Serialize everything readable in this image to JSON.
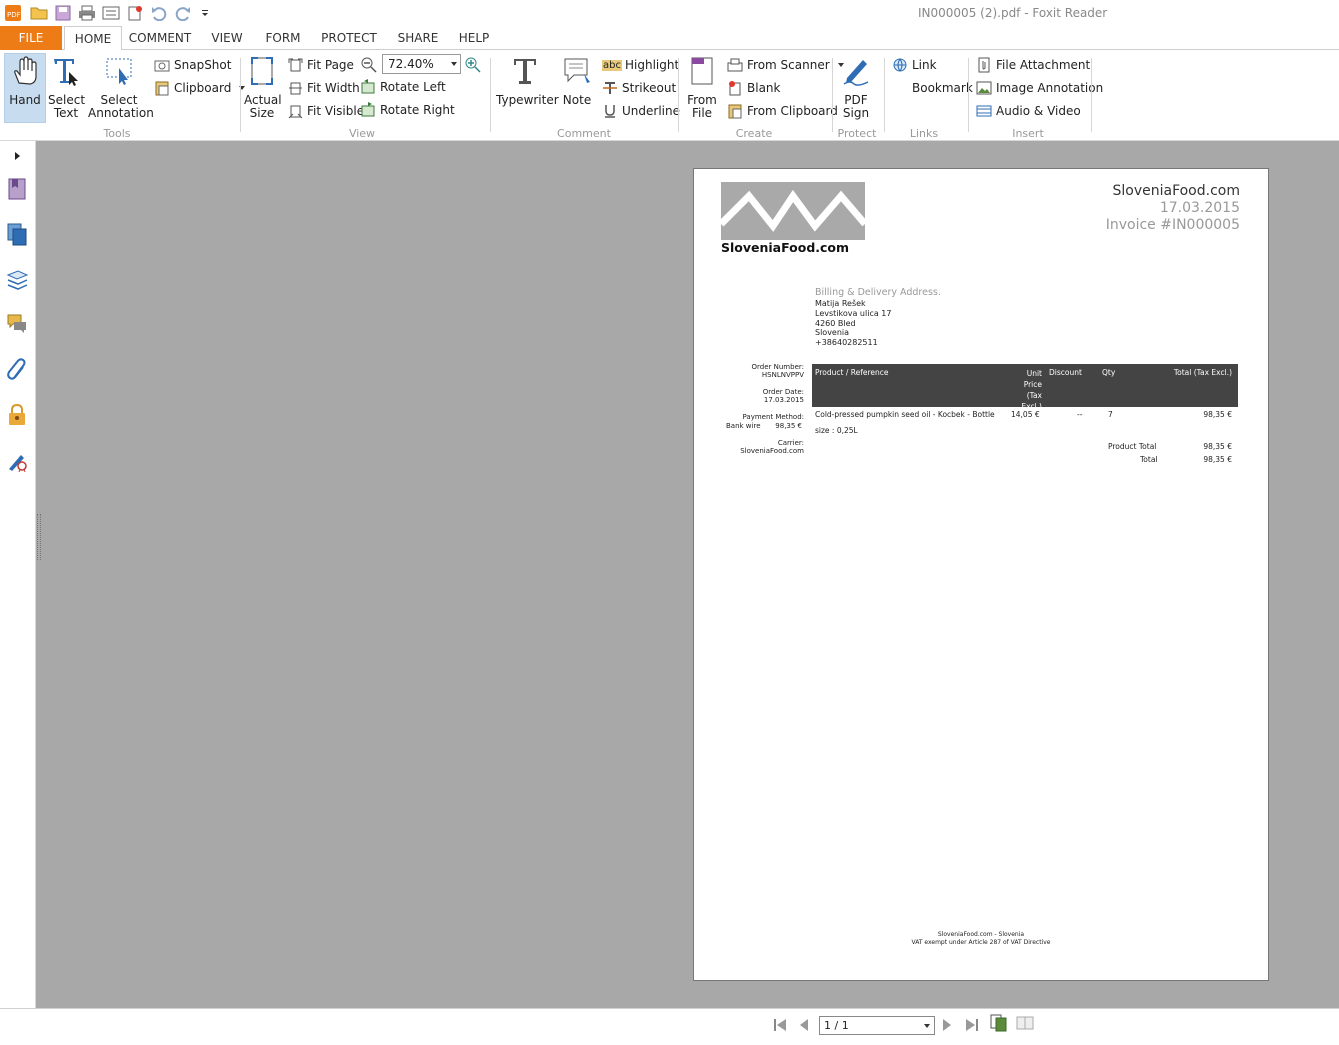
{
  "window": {
    "title": "IN000005 (2).pdf - Foxit Reader"
  },
  "tabs": [
    "FILE",
    "HOME",
    "COMMENT",
    "VIEW",
    "FORM",
    "PROTECT",
    "SHARE",
    "HELP"
  ],
  "ribbon": {
    "tools": {
      "hand": "Hand",
      "select_text_1": "Select",
      "select_text_2": "Text",
      "select_annot_1": "Select",
      "select_annot_2": "Annotation",
      "snapshot": "SnapShot",
      "clipboard": "Clipboard",
      "group": "Tools"
    },
    "view": {
      "actual_1": "Actual",
      "actual_2": "Size",
      "fit_page": "Fit Page",
      "fit_width": "Fit Width",
      "fit_visible": "Fit Visible",
      "zoom": "72.40%",
      "rotate_left": "Rotate Left",
      "rotate_right": "Rotate Right",
      "group": "View"
    },
    "comment": {
      "typewriter": "Typewriter",
      "note": "Note",
      "highlight": "Highlight",
      "strikeout": "Strikeout",
      "underline": "Underline",
      "group": "Comment",
      "abc": "abc"
    },
    "create": {
      "from_file_1": "From",
      "from_file_2": "File",
      "from_scanner": "From Scanner",
      "blank": "Blank",
      "from_clipboard": "From Clipboard",
      "group": "Create"
    },
    "protect": {
      "pdf_sign_1": "PDF",
      "pdf_sign_2": "Sign",
      "group": "Protect"
    },
    "links": {
      "link": "Link",
      "bookmark": "Bookmark",
      "group": "Links"
    },
    "insert": {
      "file_attachment": "File Attachment",
      "image_annotation": "Image Annotation",
      "audio_video": "Audio & Video",
      "group": "Insert"
    }
  },
  "status": {
    "page_indicator": "1 / 1"
  },
  "invoice": {
    "logo_text": "SloveniaFood.com",
    "shop_name": "SloveniaFood.com",
    "date": "17.03.2015",
    "invoice_no": "Invoice #IN000005",
    "address_label": "Billing & Delivery Address.",
    "address_lines": [
      "Matija Rešek",
      "Levstikova ulica 17",
      "4260 Bled",
      "Slovenia",
      "+38640282511"
    ],
    "order_number_label": "Order Number:",
    "order_number": "HSNLNVPPV",
    "order_date_label": "Order Date:",
    "order_date": "17.03.2015",
    "payment_label": "Payment Method:",
    "payment_method": "Bank wire",
    "payment_amount": "98,35 €",
    "carrier_label": "Carrier:",
    "carrier": "SloveniaFood.com",
    "table_headers": {
      "product": "Product / Reference",
      "unit_price": [
        "Unit",
        "Price",
        "(Tax",
        "Excl.)"
      ],
      "discount": "Discount",
      "qty": "Qty",
      "total": "Total (Tax Excl.)"
    },
    "item": {
      "product": "Cold-pressed pumpkin seed oil - Kocbek - Bottle",
      "variant": "size : 0,25L",
      "unit_price": "14,05 €",
      "discount": "--",
      "qty": "7",
      "total": "98,35 €"
    },
    "product_total_label": "Product Total",
    "product_total": "98,35 €",
    "total_label": "Total",
    "total": "98,35 €",
    "footer_1": "SloveniaFood.com - Slovenia",
    "footer_2": "VAT exempt under Article 287 of VAT Directive"
  },
  "colors": {
    "file_tab": "#ee7c16",
    "doc_bg": "#a8a8a8",
    "table_header": "#444444",
    "accent_blue": "#2e6db4"
  }
}
